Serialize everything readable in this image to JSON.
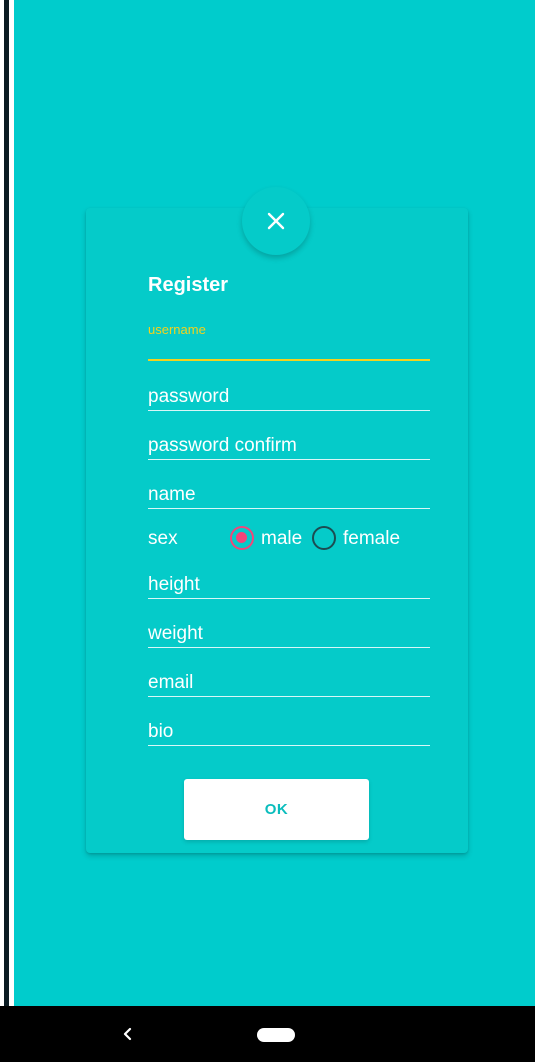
{
  "dialog": {
    "title": "Register",
    "close_icon": "close-icon",
    "username": {
      "label": "username",
      "value": ""
    },
    "fields": {
      "password": "password",
      "password_confirm": "password confirm",
      "name": "name",
      "height": "height",
      "weight": "weight",
      "email": "email",
      "bio": "bio"
    },
    "sex": {
      "label": "sex",
      "options": [
        "male",
        "female"
      ],
      "selected": "male"
    },
    "ok_label": "OK"
  },
  "colors": {
    "background": "#00cccc",
    "accent_focus": "#f4d21c",
    "radio_checked": "#f2467a",
    "radio_unchecked": "#1c4c52",
    "button_text": "#0bbdbd"
  },
  "nav": {
    "back_icon": "back-chevron-icon",
    "home_icon": "home-pill-icon"
  }
}
